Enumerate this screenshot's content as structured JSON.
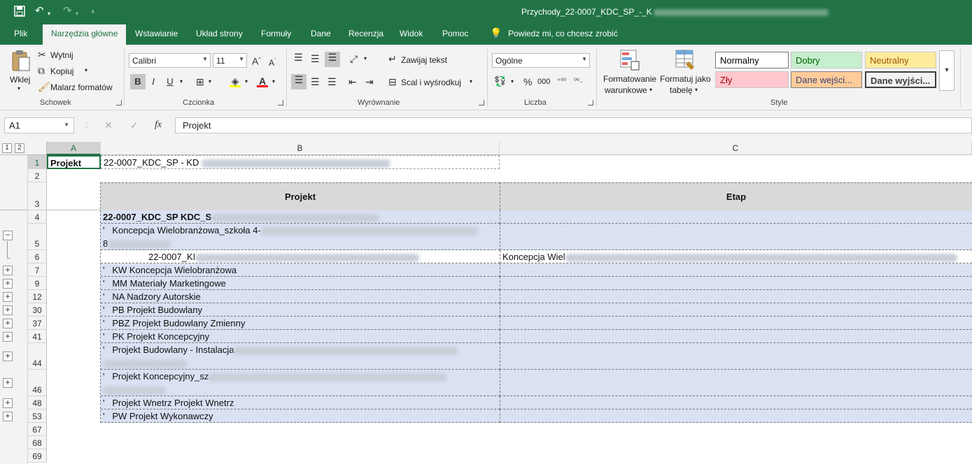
{
  "window": {
    "title": "Przychody_22-0007_KDC_SP_-_K"
  },
  "tabs": [
    "Plik",
    "Narzędzia główne",
    "Wstawianie",
    "Układ strony",
    "Formuły",
    "Dane",
    "Recenzja",
    "Widok",
    "Pomoc",
    "Powiedz mi, co chcesz zrobić"
  ],
  "ribbon": {
    "clipboard": {
      "paste": "Wklej",
      "cut": "Wytnij",
      "copy": "Kopiuj",
      "painter": "Malarz formatów",
      "label": "Schowek"
    },
    "font": {
      "name": "Calibri",
      "size": "11",
      "bold": "B",
      "italic": "I",
      "underline": "U",
      "label": "Czcionka"
    },
    "alignment": {
      "wrap": "Zawijaj tekst",
      "merge": "Scal i wyśrodkuj",
      "label": "Wyrównanie"
    },
    "number": {
      "format": "Ogólne",
      "percent": "%",
      "thousands": "000",
      "label": "Liczba"
    },
    "styles": {
      "conditional": "Formatowanie warunkowe",
      "conditional_l1": "Formatowanie",
      "conditional_l2": "warunkowe",
      "table_l1": "Formatuj jako",
      "table_l2": "tabelę",
      "label": "Style",
      "cells": [
        {
          "name": "Normalny",
          "bg": "#ffffff",
          "fg": "#000000"
        },
        {
          "name": "Dobry",
          "bg": "#c6efce",
          "fg": "#006100"
        },
        {
          "name": "Neutralny",
          "bg": "#ffeb9c",
          "fg": "#9c5700"
        },
        {
          "name": "Zły",
          "bg": "#ffc7ce",
          "fg": "#9c0006"
        },
        {
          "name": "Dane wejści...",
          "bg": "#ffcc99",
          "fg": "#3f3f76"
        },
        {
          "name": "Dane wyjści...",
          "bg": "#f2f2f2",
          "fg": "#3f3f3f"
        }
      ]
    }
  },
  "formula_bar": {
    "name_box": "A1",
    "fx": "fx",
    "value": "Projekt"
  },
  "columns": [
    "A",
    "B",
    "C"
  ],
  "outline_levels": [
    "1",
    "2"
  ],
  "rows": {
    "r1": {
      "num": "1",
      "a": "Projekt",
      "b": "22-0007_KDC_SP - KD"
    },
    "r2": {
      "num": "2"
    },
    "r3": {
      "num": "3",
      "b": "Projekt",
      "c": "Etap"
    },
    "r4": {
      "num": "4",
      "b": "22-0007_KDC_SP KDC_S"
    },
    "r5": {
      "num": "5",
      "b": "Koncepcja Wielobranżowa_szkoła 4-",
      "b2": "8"
    },
    "r6": {
      "num": "6",
      "b": "22-0007_KI",
      "c": "Koncepcja Wiel"
    },
    "r7": {
      "num": "7",
      "b": "KW Koncepcja Wielobranżowa"
    },
    "r9": {
      "num": "9",
      "b": "MM Materiały Marketingowe"
    },
    "r12": {
      "num": "12",
      "b": "NA Nadzory Autorskie"
    },
    "r30": {
      "num": "30",
      "b": "PB Projekt Budowlany"
    },
    "r37": {
      "num": "37",
      "b": "PBZ Projekt Budowlany Zmienny"
    },
    "r41": {
      "num": "41",
      "b": "PK Projekt Koncepcyjny"
    },
    "r44": {
      "num": "44",
      "b": "Projekt Budowlany - Instalacja"
    },
    "r46": {
      "num": "46",
      "b": "Projekt Koncepcyjny_sz"
    },
    "r48": {
      "num": "48",
      "b": "Projekt Wnetrz Projekt Wnetrz"
    },
    "r53": {
      "num": "53",
      "b": "PW Projekt Wykonawczy"
    },
    "r67": {
      "num": "67"
    },
    "r68": {
      "num": "68"
    },
    "r69": {
      "num": "69"
    }
  }
}
